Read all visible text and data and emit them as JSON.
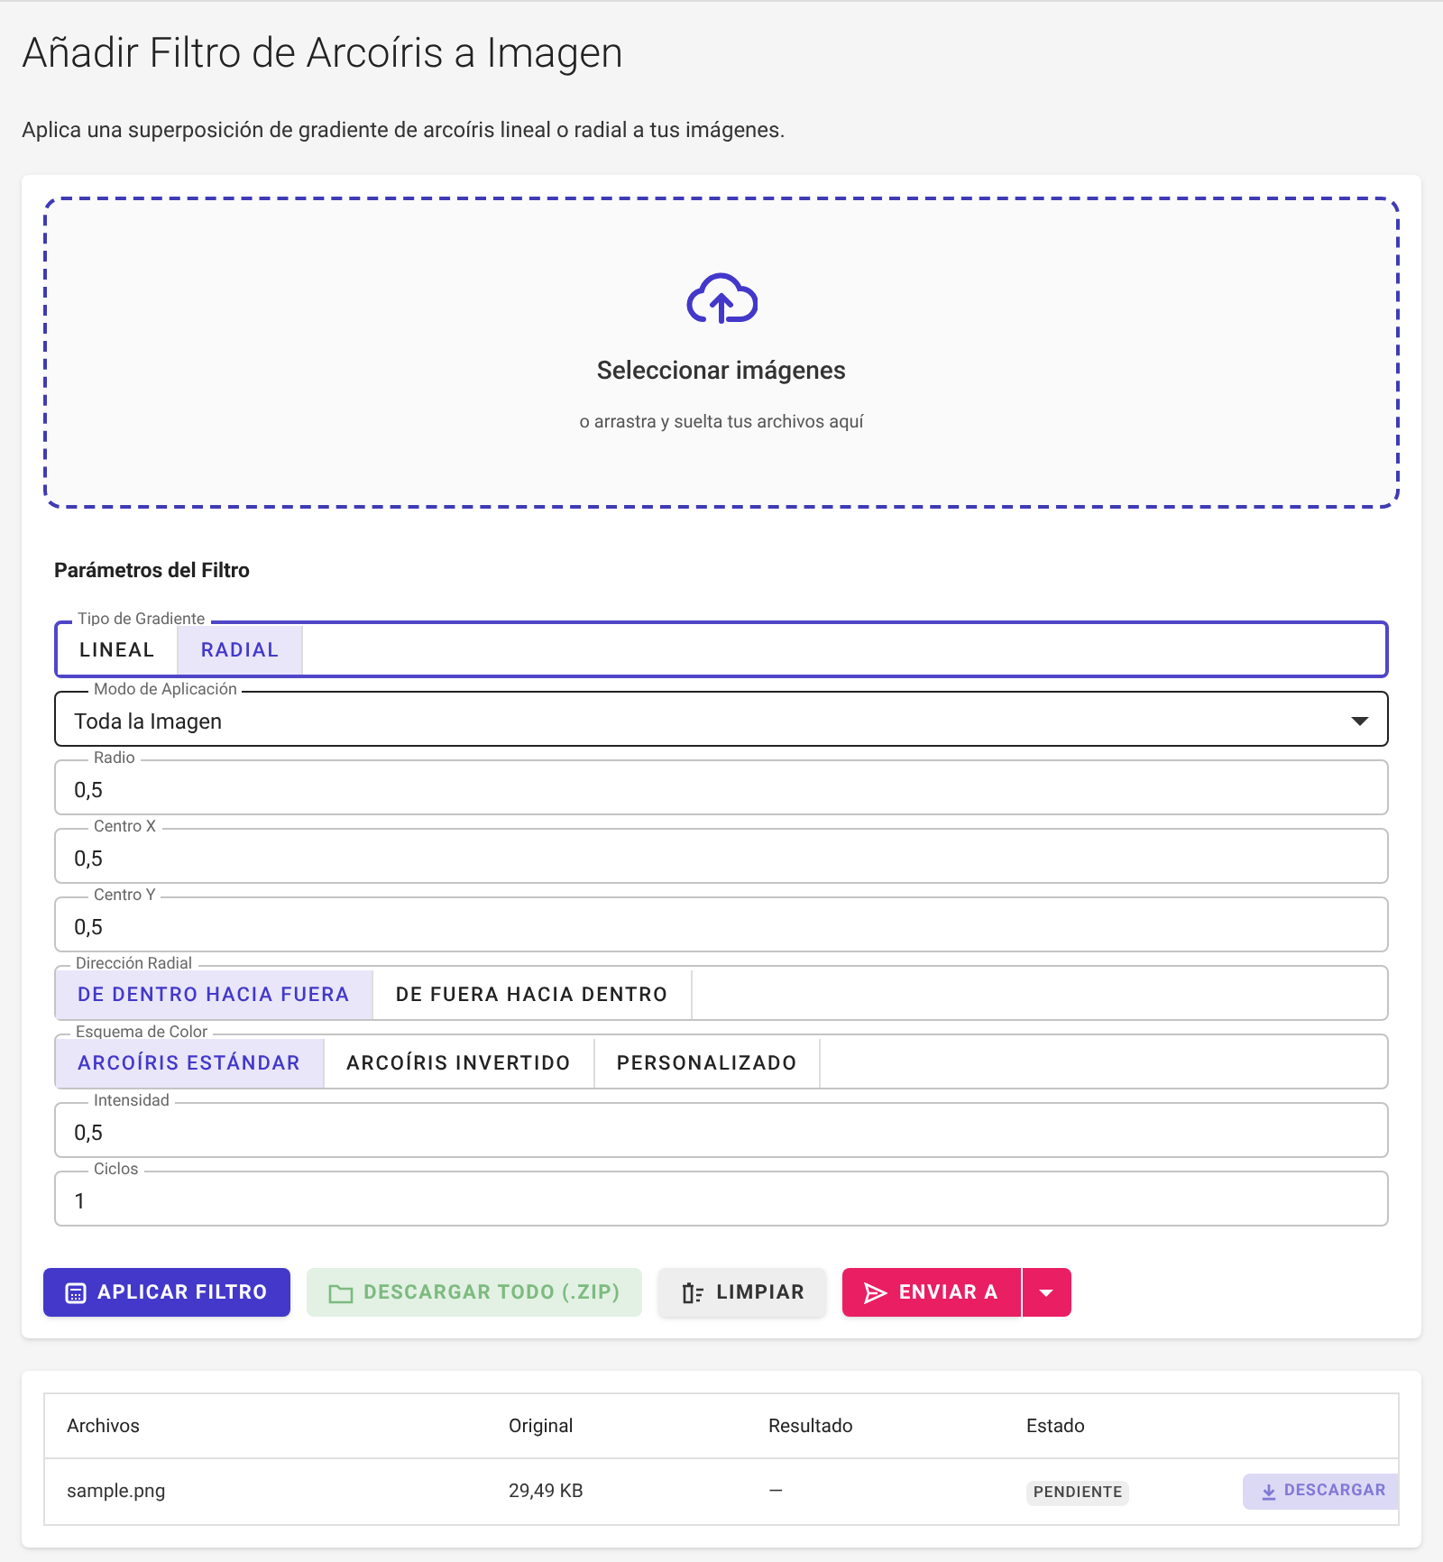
{
  "title": "Añadir Filtro de Arcoíris a Imagen",
  "subtitle": "Aplica una superposición de gradiente de arcoíris lineal o radial a tus imágenes.",
  "dropzone": {
    "title": "Seleccionar imágenes",
    "hint": "o arrastra y suelta tus archivos aquí"
  },
  "params_title": "Parámetros del Filtro",
  "fields": [
    {
      "kind": "toggle",
      "label": "Tipo de Gradiente",
      "focused": true,
      "options": [
        {
          "label": "LINEAL",
          "selected": false
        },
        {
          "label": "RADIAL",
          "selected": true
        }
      ]
    },
    {
      "kind": "select",
      "label": "Modo de Aplicación",
      "value": "Toda la Imagen"
    },
    {
      "kind": "text",
      "label": "Radio",
      "value": "0,5"
    },
    {
      "kind": "text",
      "label": "Centro X",
      "value": "0,5"
    },
    {
      "kind": "text",
      "label": "Centro Y",
      "value": "0,5"
    },
    {
      "kind": "toggle",
      "label": "Dirección Radial",
      "focused": false,
      "options": [
        {
          "label": "DE DENTRO HACIA FUERA",
          "selected": true
        },
        {
          "label": "DE FUERA HACIA DENTRO",
          "selected": false
        }
      ]
    },
    {
      "kind": "toggle",
      "label": "Esquema de Color",
      "focused": false,
      "options": [
        {
          "label": "ARCOÍRIS ESTÁNDAR",
          "selected": true
        },
        {
          "label": "ARCOÍRIS INVERTIDO",
          "selected": false
        },
        {
          "label": "PERSONALIZADO",
          "selected": false
        }
      ]
    },
    {
      "kind": "text",
      "label": "Intensidad",
      "value": "0,5"
    },
    {
      "kind": "text",
      "label": "Ciclos",
      "value": "1"
    }
  ],
  "actions": [
    {
      "kind": "apply",
      "label": "APLICAR FILTRO",
      "disabled": false
    },
    {
      "kind": "zip",
      "label": "DESCARGAR TODO (.ZIP)",
      "disabled": true
    },
    {
      "kind": "clear",
      "label": "LIMPIAR",
      "disabled": false
    },
    {
      "kind": "send",
      "label": "ENVIAR A",
      "disabled": false
    }
  ],
  "table": {
    "columns": [
      "Archivos",
      "Original",
      "Resultado",
      "Estado"
    ],
    "rows": [
      {
        "name": "sample.png",
        "original": "29,49 KB",
        "result": "—",
        "status": "PENDIENTE",
        "download": {
          "label": "DESCARGAR",
          "disabled": true
        }
      }
    ]
  }
}
